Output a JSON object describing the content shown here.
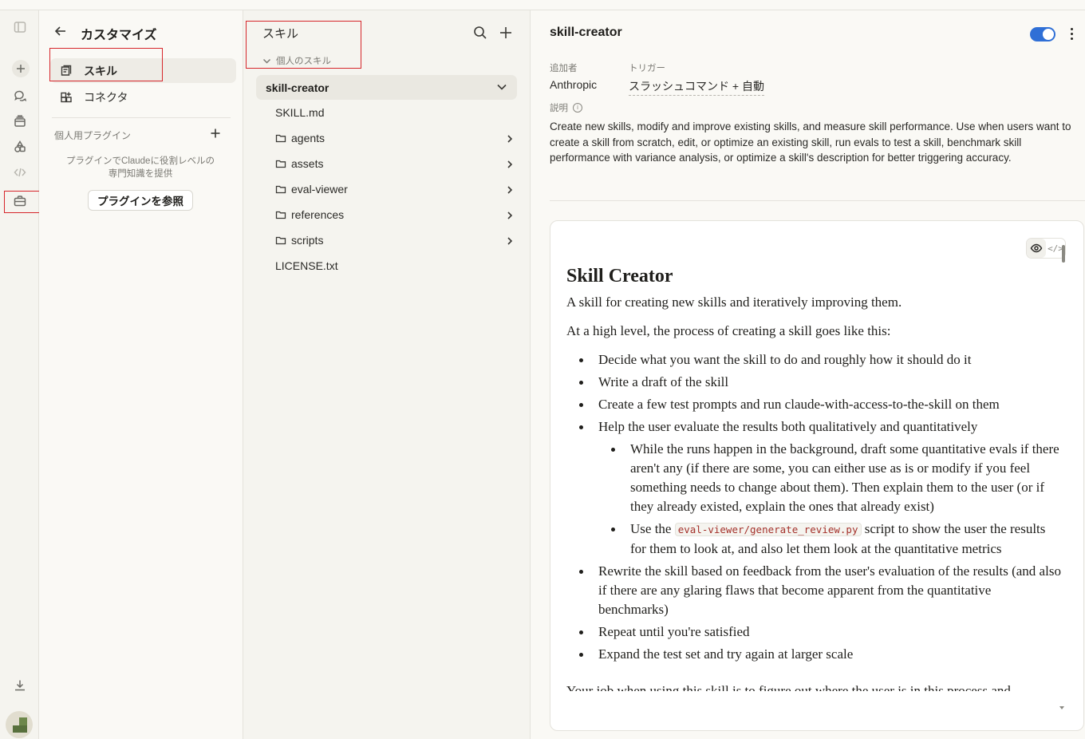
{
  "customize": {
    "title": "カスタマイズ",
    "nav": [
      {
        "label": "スキル"
      },
      {
        "label": "コネクタ"
      }
    ],
    "plugins_heading": "個人用プラグイン",
    "plugins_desc_line1": "プラグインでClaudeに役割レベルの",
    "plugins_desc_line2": "専門知識を提供",
    "plugins_button": "プラグインを参照"
  },
  "files": {
    "title": "スキル",
    "section": "個人のスキル",
    "skill_name": "skill-creator",
    "items": [
      {
        "label": "SKILL.md"
      },
      {
        "label": "agents"
      },
      {
        "label": "assets"
      },
      {
        "label": "eval-viewer"
      },
      {
        "label": "references"
      },
      {
        "label": "scripts"
      },
      {
        "label": "LICENSE.txt"
      }
    ]
  },
  "detail": {
    "title": "skill-creator",
    "enabled": true,
    "added_by_label": "追加者",
    "added_by_value": "Anthropic",
    "trigger_label": "トリガー",
    "trigger_value": "スラッシュコマンド + 自動",
    "description_label": "説明",
    "description": "Create new skills, modify and improve existing skills, and measure skill performance. Use when users want to create a skill from scratch, edit, or optimize an existing skill, run evals to test a skill, benchmark skill performance with variance analysis, or optimize a skill's description for better triggering accuracy."
  },
  "markdown": {
    "h1": "Skill Creator",
    "p1": "A skill for creating new skills and iteratively improving them.",
    "p2": "At a high level, the process of creating a skill goes like this:",
    "b1": "Decide what you want the skill to do and roughly how it should do it",
    "b2": "Write a draft of the skill",
    "b3": "Create a few test prompts and run claude-with-access-to-the-skill on them",
    "b4": "Help the user evaluate the results both qualitatively and quantitatively",
    "b4a": "While the runs happen in the background, draft some quantitative evals if there aren't any (if there are some, you can either use as is or modify if you feel something needs to change about them). Then explain them to the user (or if they already existed, explain the ones that already exist)",
    "b4b_pre": "Use the",
    "b4b_code": "eval-viewer/generate_review.py",
    "b4b_post": "script to show the user the results for them to look at, and also let them look at the quantitative metrics",
    "b5": "Rewrite the skill based on feedback from the user's evaluation of the results (and also if there are any glaring flaws that become apparent from the quantitative benchmarks)",
    "b6": "Repeat until you're satisfied",
    "b7": "Expand the test set and try again at larger scale",
    "cut": "Your job when using this skill is to figure out where the user is in this process and"
  }
}
